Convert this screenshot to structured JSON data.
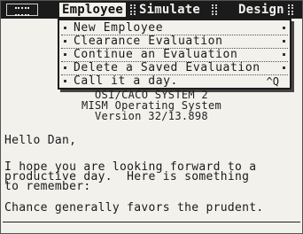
{
  "menubar": {
    "menus": [
      {
        "label": "Employee",
        "active": true
      },
      {
        "label": "Simulate",
        "active": false
      },
      {
        "label": "Design",
        "active": false
      }
    ]
  },
  "dropdown": {
    "items": [
      {
        "label": "New Employee",
        "shortcut": ""
      },
      {
        "label": "Clearance Evaluation",
        "shortcut": ""
      },
      {
        "label": "Continue an Evaluation",
        "shortcut": ""
      },
      {
        "label": "Delete a Saved Evaluation",
        "shortcut": ""
      },
      {
        "label": "Call it a day.",
        "shortcut": "^Q"
      }
    ]
  },
  "banner": {
    "line1": "OSI/CACO SYSTEM 2",
    "line2": "MISM Operating System",
    "line3": "Version 32/13.898"
  },
  "terminal": {
    "greeting": "Hello Dan,",
    "message_line1": "I hope you are looking forward to a",
    "message_line2": "productive day.  Here is something",
    "message_line3": "to remember:",
    "quote": "Chance generally favors the prudent."
  }
}
